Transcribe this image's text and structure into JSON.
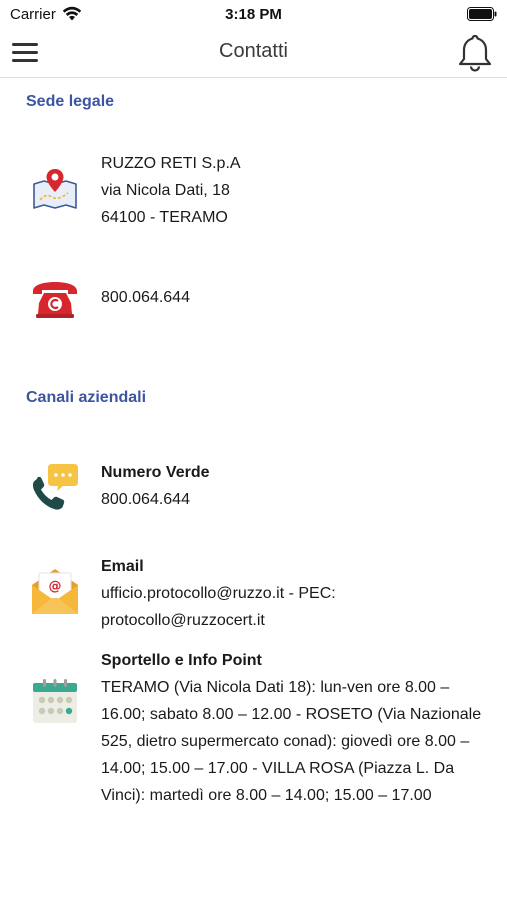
{
  "status_bar": {
    "carrier": "Carrier",
    "time": "3:18 PM"
  },
  "nav": {
    "title": "Contatti",
    "menu_icon": "hamburger-menu-icon",
    "bell_icon": "bell-icon"
  },
  "sede_legale": {
    "title": "Sede legale",
    "address": {
      "icon": "map-pin-icon",
      "lines": [
        "RUZZO RETI S.p.A",
        "via Nicola Dati, 18",
        "64100 - TERAMO"
      ]
    },
    "phone": {
      "icon": "telephone-icon",
      "number": "800.064.644"
    }
  },
  "canali_aziendali": {
    "title": "Canali aziendali",
    "numero_verde": {
      "icon": "phone-chat-icon",
      "label": "Numero Verde",
      "value": "800.064.644"
    },
    "email": {
      "icon": "email-envelope-icon",
      "label": "Email",
      "value": "ufficio.protocollo@ruzzo.it - PEC: protocollo@ruzzocert.it"
    },
    "sportello": {
      "icon": "calendar-icon",
      "label": "Sportello e Info Point",
      "value": "TERAMO (Via Nicola Dati 18): lun-ven ore 8.00 – 16.00; sabato 8.00 – 12.00 - ROSETO (Via Nazionale 525, dietro supermercato conad): giovedì ore 8.00 – 14.00; 15.00 – 17.00 - VILLA ROSA (Piazza L. Da Vinci): martedì ore 8.00 – 14.00; 15.00 – 17.00"
    }
  },
  "colors": {
    "section_title": "#3c55a3",
    "divider": "#dedede",
    "phone_red": "#d8262e",
    "phone_dark_green": "#1f4a45",
    "bubble_yellow": "#f5c443",
    "envelope_yellow": "#f5b83a",
    "calendar_teal": "#3aa98f"
  }
}
